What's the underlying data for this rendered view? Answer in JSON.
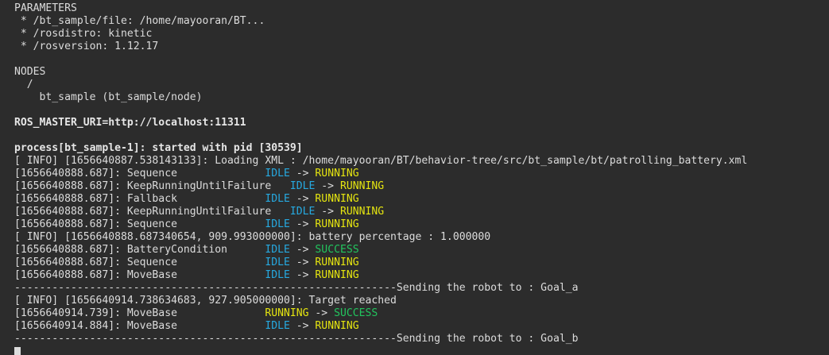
{
  "terminal": {
    "params_header": "PARAMETERS",
    "param_file": " * /bt_sample/file: /home/mayooran/BT...",
    "param_rosdistro": " * /rosdistro: kinetic",
    "param_rosversion": " * /rosversion: 1.12.17",
    "nodes_header": "NODES",
    "nodes_root": "  /",
    "nodes_item": "    bt_sample (bt_sample/node)",
    "master_uri": "ROS_MASTER_URI=http://localhost:11311",
    "process_started": "process[bt_sample-1]: started with pid [30539]",
    "info_loading": "[ INFO] [1656640887.538143133]: Loading XML : /home/mayooran/BT/behavior-tree/src/bt_sample/bt/patrolling_battery.xml",
    "t1": {
      "prefix": "[1656640888.687]: Sequence              ",
      "from": "IDLE",
      "arrow": " -> ",
      "to": "RUNNING"
    },
    "t2": {
      "prefix": "[1656640888.687]: KeepRunningUntilFailure   ",
      "from": "IDLE",
      "arrow": " -> ",
      "to": "RUNNING"
    },
    "t3": {
      "prefix": "[1656640888.687]: Fallback              ",
      "from": "IDLE",
      "arrow": " -> ",
      "to": "RUNNING"
    },
    "t4": {
      "prefix": "[1656640888.687]: KeepRunningUntilFailure   ",
      "from": "IDLE",
      "arrow": " -> ",
      "to": "RUNNING"
    },
    "t5": {
      "prefix": "[1656640888.687]: Sequence              ",
      "from": "IDLE",
      "arrow": " -> ",
      "to": "RUNNING"
    },
    "info_battery": "[ INFO] [1656640888.687340654, 909.993000000]: battery percentage : 1.000000",
    "t6": {
      "prefix": "[1656640888.687]: BatteryCondition      ",
      "from": "IDLE",
      "arrow": " -> ",
      "to": "SUCCESS"
    },
    "t7": {
      "prefix": "[1656640888.687]: Sequence              ",
      "from": "IDLE",
      "arrow": " -> ",
      "to": "RUNNING"
    },
    "t8": {
      "prefix": "[1656640888.687]: MoveBase              ",
      "from": "IDLE",
      "arrow": " -> ",
      "to": "RUNNING"
    },
    "sep_goal_a": "-------------------------------------------------------------Sending the robot to : Goal_a",
    "info_target": "[ INFO] [1656640914.738634683, 927.905000000]: Target reached",
    "t9": {
      "prefix": "[1656640914.739]: MoveBase              ",
      "from": "RUNNING",
      "arrow": " -> ",
      "to": "SUCCESS"
    },
    "t10": {
      "prefix": "[1656640914.884]: MoveBase              ",
      "from": "IDLE",
      "arrow": " -> ",
      "to": "RUNNING"
    },
    "sep_goal_b": "-------------------------------------------------------------Sending the robot to : Goal_b"
  },
  "colors": {
    "background": "#2c2c2c",
    "text": "#dcdcdc",
    "idle": "#26a9e0",
    "running": "#e5e510",
    "success": "#22c55e"
  }
}
